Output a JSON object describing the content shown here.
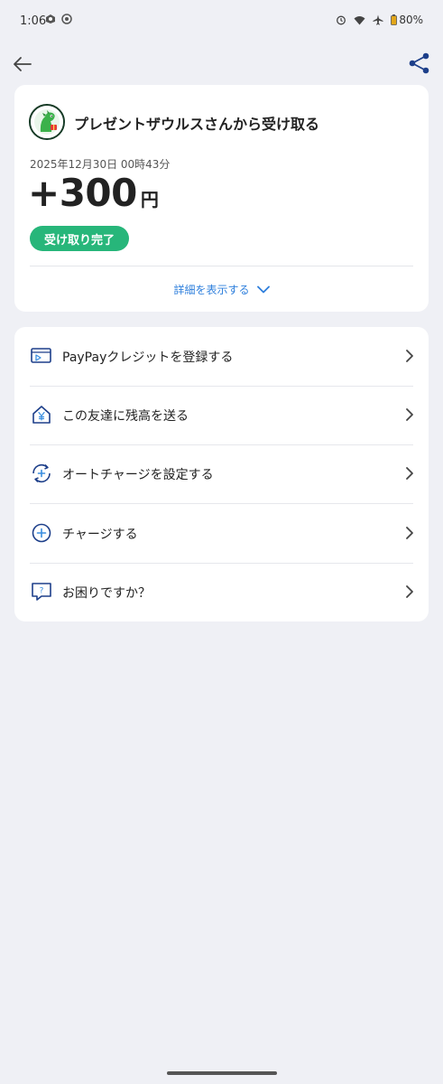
{
  "status_bar": {
    "time": "1:06",
    "battery": "80%"
  },
  "header": {
    "back_icon": "arrow-left-icon",
    "share_icon": "share-icon"
  },
  "transaction": {
    "title": "プレゼントザウルスさんから受け取る",
    "date": "2025年12月30日 00時43分",
    "amount": "+300",
    "currency": "円",
    "status": "受け取り完了",
    "details_link": "詳細を表示する",
    "status_color": "#27b67a",
    "link_color": "#2e7fdc"
  },
  "menu": {
    "items": [
      {
        "label": "PayPayクレジットを登録する",
        "icon": "credit-card-icon"
      },
      {
        "label": "この友達に残高を送る",
        "icon": "send-yen-icon"
      },
      {
        "label": "オートチャージを設定する",
        "icon": "auto-charge-icon"
      },
      {
        "label": "チャージする",
        "icon": "plus-circle-icon"
      },
      {
        "label": "お困りですか？",
        "icon": "help-chat-icon"
      }
    ]
  }
}
